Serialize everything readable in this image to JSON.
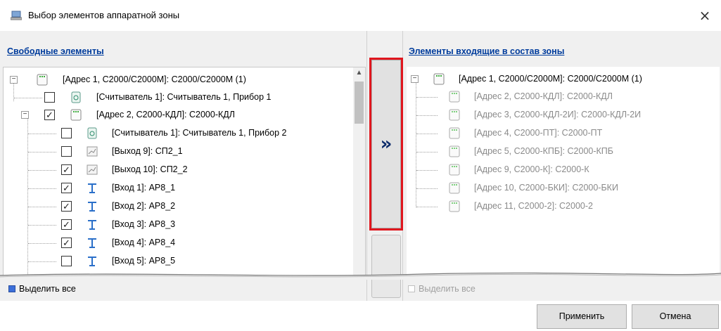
{
  "window": {
    "title": "Выбор элементов аппаратной зоны",
    "close": "×"
  },
  "left": {
    "header": "Свободные элементы",
    "rows": [
      {
        "label": "[Адрес 1, С2000/С2000М]: С2000/С2000М (1)",
        "expander": "−",
        "check": null,
        "icon": "device-icon"
      },
      {
        "label": "[Считыватель 1]: Считыватель 1, Прибор 1",
        "expander": null,
        "check": "",
        "icon": "reader-icon"
      },
      {
        "label": "[Адрес 2, С2000-КДЛ]: С2000-КДЛ",
        "expander": "−",
        "check": "✓",
        "icon": "device-icon"
      },
      {
        "label": "[Считыватель 1]: Считыватель 1, Прибор 2",
        "expander": null,
        "check": "",
        "icon": "reader-icon"
      },
      {
        "label": "[Выход 9]: СП2_1",
        "expander": null,
        "check": "",
        "icon": "output-icon"
      },
      {
        "label": "[Выход 10]: СП2_2",
        "expander": null,
        "check": "✓",
        "icon": "output-icon"
      },
      {
        "label": "[Вход 1]: АР8_1",
        "expander": null,
        "check": "✓",
        "icon": "input-icon"
      },
      {
        "label": "[Вход 2]: АР8_2",
        "expander": null,
        "check": "✓",
        "icon": "input-icon"
      },
      {
        "label": "[Вход 3]: АР8_3",
        "expander": null,
        "check": "✓",
        "icon": "input-icon"
      },
      {
        "label": "[Вход 4]: АР8_4",
        "expander": null,
        "check": "✓",
        "icon": "input-icon"
      },
      {
        "label": "[Вход 5]: АР8_5",
        "expander": null,
        "check": "",
        "icon": "input-icon"
      }
    ],
    "select_all": "Выделить все"
  },
  "middle": {
    "move_label": "»"
  },
  "right": {
    "header": "Элементы входящие в состав зоны",
    "rows": [
      {
        "label": "[Адрес 1, С2000/С2000М]: С2000/С2000М (1)",
        "expander": "−",
        "gray": false
      },
      {
        "label": "[Адрес 2, С2000-КДЛ]: С2000-КДЛ",
        "expander": null,
        "gray": true
      },
      {
        "label": "[Адрес 3, С2000-КДЛ-2И]: С2000-КДЛ-2И",
        "expander": null,
        "gray": true
      },
      {
        "label": "[Адрес 4, С2000-ПТ]: С2000-ПТ",
        "expander": null,
        "gray": true
      },
      {
        "label": "[Адрес 5, С2000-КПБ]: С2000-КПБ",
        "expander": null,
        "gray": true
      },
      {
        "label": "[Адрес 9, С2000-К]: С2000-К",
        "expander": null,
        "gray": true
      },
      {
        "label": "[Адрес 10, С2000-БКИ]: С2000-БКИ",
        "expander": null,
        "gray": true
      },
      {
        "label": "[Адрес 11, С2000-2]: С2000-2",
        "expander": null,
        "gray": true
      }
    ],
    "select_all": "Выделить все"
  },
  "footer": {
    "apply": "Применить",
    "cancel": "Отмена"
  },
  "colors": {
    "header_link": "#003c9c",
    "highlight": "#e0161e",
    "select_all_box": "#3c6fd9"
  }
}
